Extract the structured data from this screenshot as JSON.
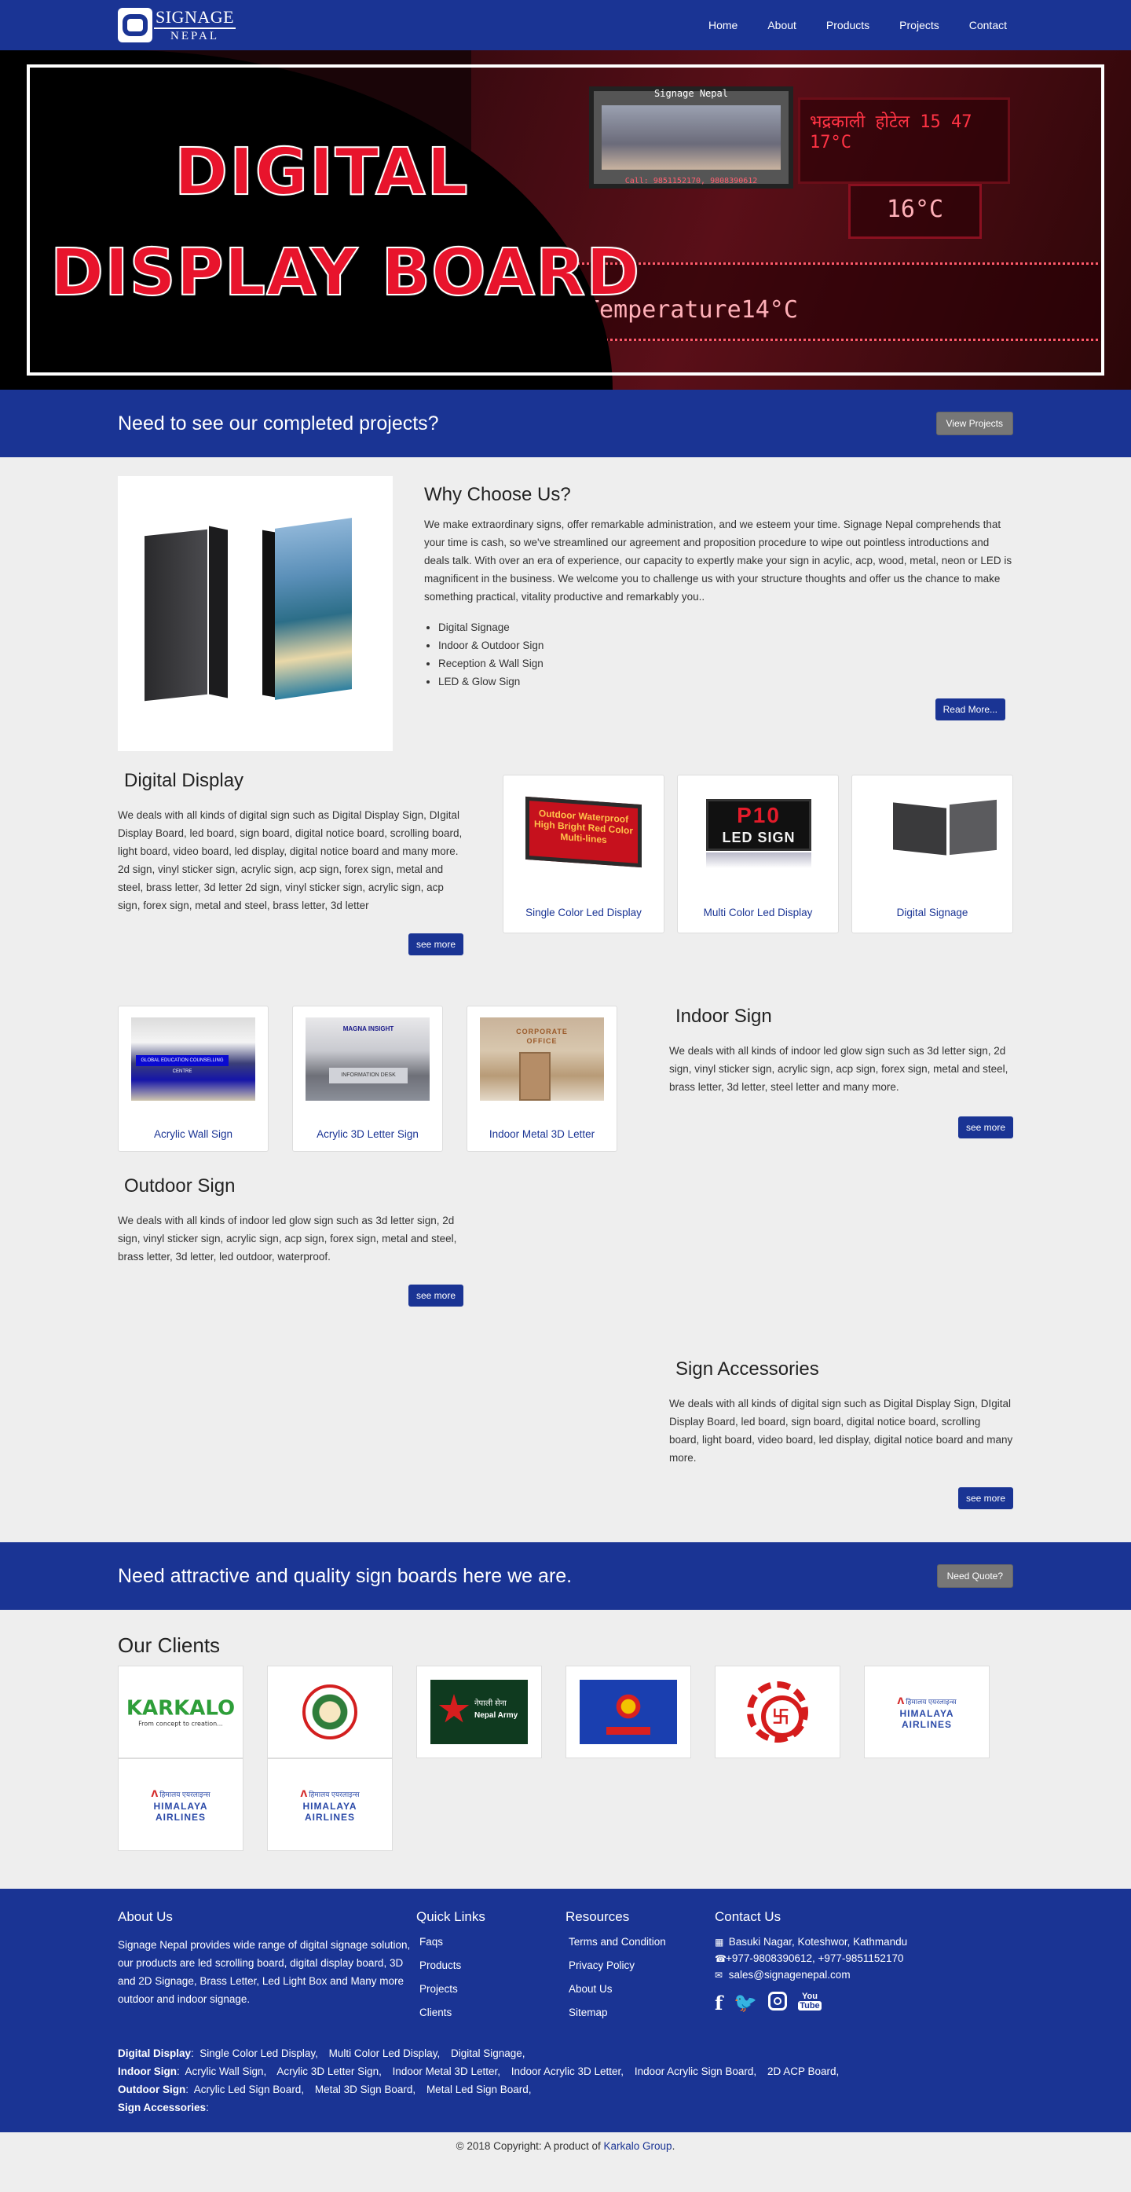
{
  "nav": {
    "logo_line1": "SIGNAGE",
    "logo_line2": "NEPAL",
    "links": [
      "Home",
      "About",
      "Products",
      "Projects",
      "Contact"
    ]
  },
  "hero": {
    "title_line1": "DIGITAL",
    "title_line2": "DISPLAY BOARD",
    "led_temp": "Temperature14°C",
    "led_16": "16°C",
    "led_hotel": "भद्रकाली होटेल  15 47  17°C",
    "screen_caption": "Signage Nepal",
    "screen_call": "Call: 9851152170, 9808390612"
  },
  "cta1": {
    "heading": "Need to see our completed projects?",
    "button": "View Projects"
  },
  "why": {
    "heading": "Why Choose Us?",
    "text": "We make extraordinary signs, offer remarkable administration, and we esteem your time. Signage Nepal comprehends that your time is cash, so we've streamlined our agreement and proposition procedure to wipe out pointless introductions and deals talk. With over an era of experience, our capacity to expertly make your sign in acylic, acp, wood, metal, neon or LED is magnificent in the business. We welcome you to challenge us with your structure thoughts and offer us the chance to make something practical, vitality productive and remarkably you..",
    "list": [
      "Digital Signage",
      "Indoor & Outdoor Sign",
      "Reception & Wall Sign",
      "LED & Glow Sign"
    ],
    "button": "Read More..."
  },
  "digital": {
    "heading": "Digital Display",
    "text": "We deals with all kinds of digital sign such as Digital Display Sign, DIgital Display Board, led board, sign board, digital notice board, scrolling board, light board, video board,  led display, digital notice board and many more. 2d sign, vinyl sticker sign, acrylic sign, acp sign, forex sign,  metal and steel, brass letter, 3d letter 2d sign, vinyl sticker sign, acrylic sign, acp sign, forex sign,  metal and steel, brass letter, 3d letter",
    "button": "see more",
    "cards": [
      "Single Color Led Display",
      "Multi Color Led Display",
      "Digital Signage"
    ],
    "single_led_text": "Outdoor Waterproof High Bright Red Color Multi-lines",
    "multi_led_a": "P10",
    "multi_led_b": "LED SIGN"
  },
  "indoor": {
    "heading": "Indoor Sign",
    "text": "We deals with all kinds of indoor led glow sign such as 3d letter sign, 2d sign, vinyl sticker sign, acrylic sign, acp sign, forex sign, metal and steel, brass letter, 3d letter, steel letter and many more.",
    "button": "see more",
    "cards": [
      "Acrylic Wall Sign",
      "Acrylic 3D Letter Sign",
      "Indoor Metal 3D Letter"
    ],
    "acrylic_banner": "GLOBAL EDUCATION COUNSELLING CENTRE",
    "desk_banner": "MAGNA INSIGHT",
    "desk_text": "INFORMATION DESK",
    "metal_text": "CORPORATE OFFICE"
  },
  "outdoor": {
    "heading": "Outdoor Sign",
    "text": "We deals with all kinds of indoor led glow sign such as 3d letter sign, 2d sign, vinyl sticker sign, acrylic sign, acp sign, forex sign, metal and steel, brass letter, 3d letter, led outdoor, waterproof.",
    "button": "see more"
  },
  "accessories": {
    "heading": "Sign Accessories",
    "text": "We deals with all kinds of digital sign such as Digital Display Sign, DIgital Display Board, led board, sign board, digital notice board, scrolling board, light board, video board,  led display, digital notice board and many more.",
    "button": "see more"
  },
  "cta2": {
    "heading": "Need attractive and quality sign boards here we are.",
    "button": "Need Quote?"
  },
  "clients": {
    "heading": "Our Clients",
    "karkalo": "KARKALO",
    "karkalo_tag": "From concept to creation...",
    "army_dv": "नेपाली सेना",
    "army_en": "Nepal Army",
    "himalaya_dv": "हिमालय एयरलाइन्स",
    "himalaya_en": "HIMALAYA AIRLINES"
  },
  "footer": {
    "about_title": "About Us",
    "about_text": "Signage Nepal provides wide range of digital signage solution, our products are led scrolling board, digital display board, 3D and 2D Signage, Brass Letter, Led Light Box and Many more outdoor and indoor signage.",
    "links_title": "Quick Links",
    "links": [
      "Faqs",
      "Products",
      "Projects",
      "Clients"
    ],
    "res_title": "Resources",
    "resources": [
      "Terms and Condition",
      "Privacy Policy",
      "About Us",
      "Sitemap"
    ],
    "contact_title": "Contact Us",
    "address": "Basuki Nagar, Koteshwor, Kathmandu",
    "phone": "+977-9808390612, +977-9851152170",
    "email": "sales@signagenepal.com",
    "cat_digital_label": "Digital Display",
    "cat_digital": [
      "Single Color Led Display,",
      "Multi Color Led Display,",
      "Digital Signage,"
    ],
    "cat_indoor_label": "Indoor Sign",
    "cat_indoor": [
      "Acrylic Wall Sign,",
      "Acrylic 3D Letter Sign,",
      "Indoor Metal 3D Letter,",
      "Indoor Acrylic 3D Letter,",
      "Indoor Acrylic Sign Board,",
      "2D ACP Board,"
    ],
    "cat_outdoor_label": "Outdoor Sign",
    "cat_outdoor": [
      "Acrylic Led Sign Board,",
      "Metal 3D Sign Board,",
      "Metal Led Sign Board,"
    ],
    "cat_acc_label": "Sign Accessories",
    "copyright_prefix": "© 2018 Copyright: A product of",
    "copyright_link": "Karkalo Group",
    "copyright_suffix": "."
  },
  "colors": {
    "brand": "#1a3494",
    "page_bg": "#eeeeee",
    "hero_red": "#e8142c"
  }
}
